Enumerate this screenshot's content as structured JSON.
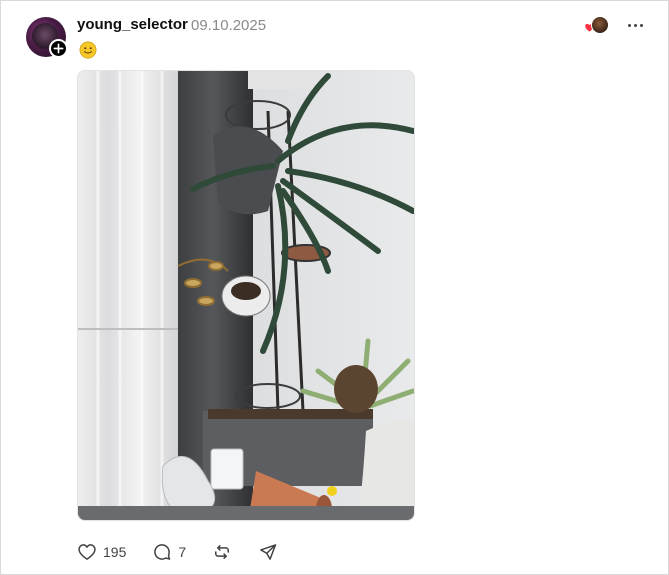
{
  "post": {
    "username": "young_selector",
    "date": "09.10.2025",
    "caption_emoji": "slightly-smiling-face",
    "photo": {
      "description_icon": "photo-plants-window"
    },
    "stats": {
      "likes": "195",
      "replies": "7"
    }
  },
  "icons": {
    "follow": "plus-icon",
    "more": "more-icon",
    "like": "heart-icon",
    "reply": "comment-icon",
    "repost": "repost-icon",
    "share": "send-icon"
  },
  "colors": {
    "text": "#101010",
    "muted": "#8a8a8a",
    "icon": "#424242",
    "heart_red": "#ff3040"
  }
}
